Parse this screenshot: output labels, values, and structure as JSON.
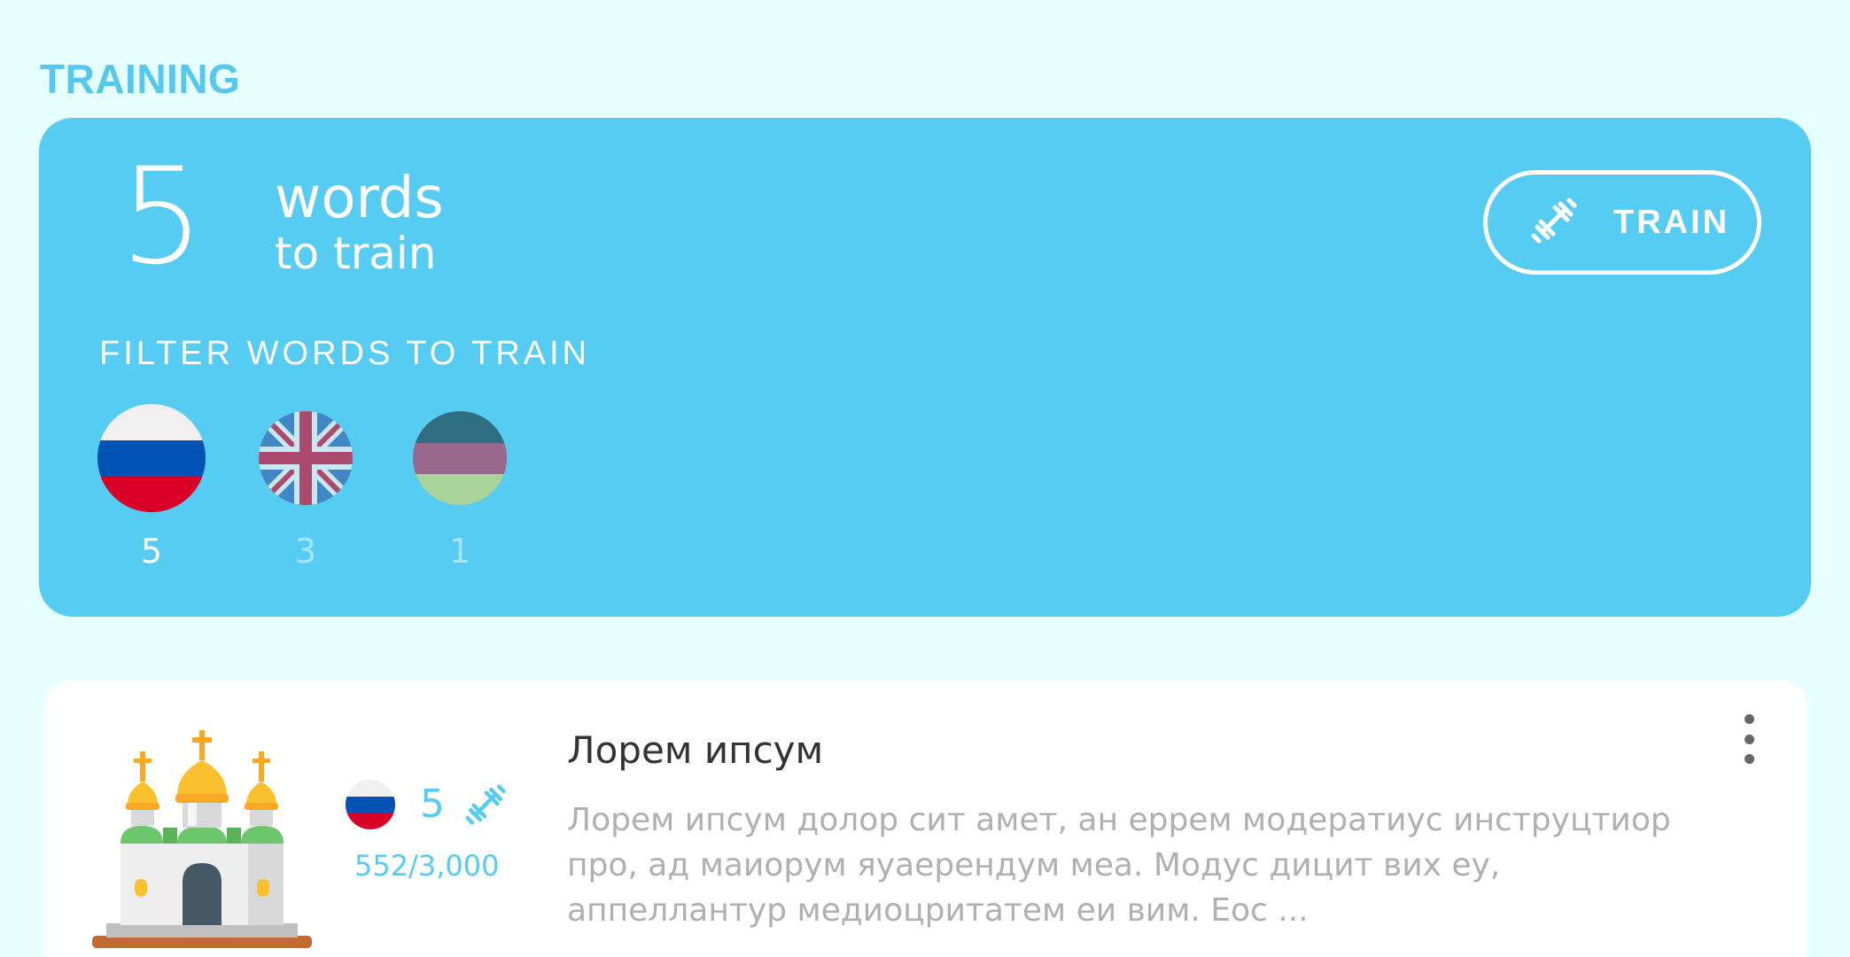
{
  "section": {
    "title": "TRAINING"
  },
  "training": {
    "count": "5",
    "words_label": "words",
    "to_train_label": "to train",
    "train_button_label": "TRAIN",
    "filter_title": "FILTER WORDS TO TRAIN",
    "filters": [
      {
        "language": "russian",
        "count": "5",
        "selected": true
      },
      {
        "language": "english",
        "count": "3",
        "selected": false
      },
      {
        "language": "other",
        "count": "1",
        "selected": false
      }
    ]
  },
  "deck": {
    "title": "Лорем ипсум",
    "description": "Лорем ипсум долор сит амет, ан еррем модератиус инструцтиор про, ад маиорум яуаерендум меа. Модус дицит вих еу, аппеллантур медиоцритатем еи вим. Еос ...",
    "language": "russian",
    "train_count": "5",
    "progress": "552/3,000",
    "image_icon": "cathedral-icon"
  },
  "colors": {
    "background": "#e6ffff",
    "accent": "#56ccf2",
    "card": "#ffffff"
  }
}
